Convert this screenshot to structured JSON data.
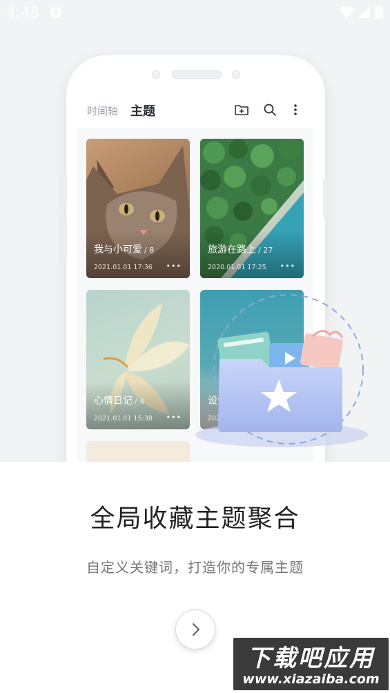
{
  "status_bar": {
    "time": "4:48",
    "notification_icon": "A"
  },
  "app_header": {
    "tab_timeline": "时间轴",
    "tab_topics": "主题"
  },
  "cards": [
    {
      "title": "我与小可爱",
      "count": "/ 8",
      "date": "2021.01.01  17:36",
      "more": "•••"
    },
    {
      "title": "旅游在路上",
      "count": "/ 27",
      "date": "2020.01.01  17:25",
      "more": "•••"
    },
    {
      "title": "心情日记",
      "count": "/ 4",
      "date": "2021.01.01  15:38",
      "more": "•••"
    },
    {
      "title": "设计",
      "count": "",
      "date": "2021",
      "more": ""
    }
  ],
  "onboarding": {
    "headline": "全局收藏主题聚合",
    "subline": "自定义关键词，打造你的专属主题"
  },
  "watermark": {
    "big": "下载吧应用",
    "small": "www.xiazaiba.com"
  },
  "colors": {
    "page_bg_top": "#f2f3f5",
    "headline": "#222222",
    "subline": "#777777",
    "folder_blue": "#b7c6f2"
  }
}
